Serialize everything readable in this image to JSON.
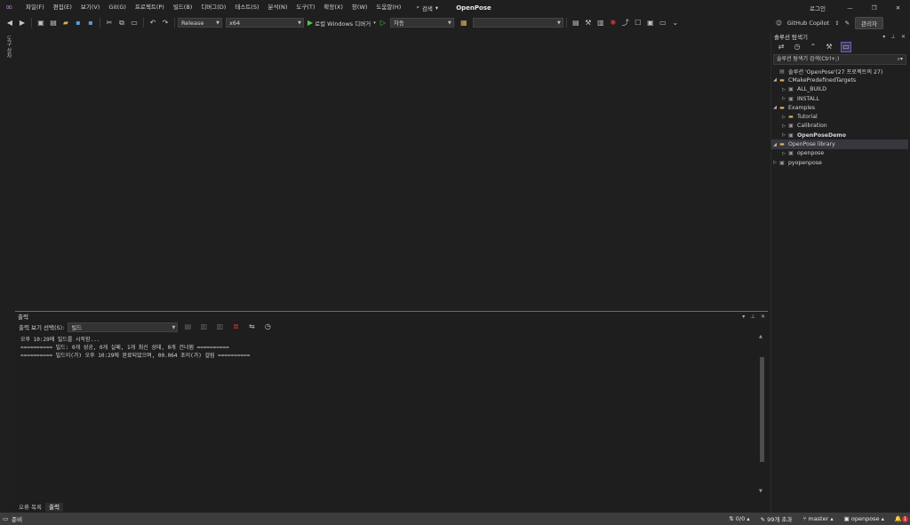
{
  "titlebar": {
    "menu": [
      "파일(F)",
      "편집(E)",
      "보기(V)",
      "Git(G)",
      "프로젝트(P)",
      "빌드(B)",
      "디버그(D)",
      "테스트(S)",
      "분석(N)",
      "도구(T)",
      "확장(X)",
      "창(W)",
      "도움말(H)"
    ],
    "search_label": "검색",
    "project_name": "OpenPose",
    "login_label": "로그인",
    "copilot_label": "GitHub Copilot",
    "admin_label": "관리자"
  },
  "toolbar": {
    "configuration": "Release",
    "platform": "x64",
    "run_label": "로컬 Windows 디버거",
    "auto_label": "자동",
    "extra_combo": ""
  },
  "left_gutter": {
    "label": "도구 상자"
  },
  "output": {
    "title": "출력",
    "source_label": "출력 보기 선택(S):",
    "source_value": "빌드",
    "lines": [
      "오후 10:29에 빌드를 시작함...",
      "========== 빌드: 0개 성공, 0개 실패, 1개 최신 상태, 0개 건너뜀 ==========",
      "========== 빌드이(가) 오후 10:29에 완료되었으며, 00.064 초이(가) 걸림 =========="
    ],
    "tabs": [
      "오류 목록",
      "출력"
    ]
  },
  "solution": {
    "title": "솔루션 탐색기",
    "search_placeholder": "솔루션 탐색기 검색(Ctrl+;)",
    "root": "솔루션 'OpenPose'(27 프로젝트의 27)",
    "nodes": [
      {
        "label": "CMakePredefinedTargets",
        "type": "folder",
        "expanded": true
      },
      {
        "label": "ALL_BUILD",
        "type": "project"
      },
      {
        "label": "INSTALL",
        "type": "project"
      },
      {
        "label": "Examples",
        "type": "folder",
        "expanded": true
      },
      {
        "label": "Tutorial",
        "type": "folder"
      },
      {
        "label": "Calibration",
        "type": "project"
      },
      {
        "label": "OpenPoseDemo",
        "type": "project",
        "bold": true
      },
      {
        "label": "OpenPose library",
        "type": "folder",
        "expanded": true,
        "selected": true
      },
      {
        "label": "openpose",
        "type": "project"
      },
      {
        "label": "pyopenpose",
        "type": "project"
      }
    ]
  },
  "statusbar": {
    "ready": "준비",
    "changes": "0/0",
    "commits": "99개 초과",
    "branch": "master",
    "repo": "openpose",
    "notif_count": "1"
  }
}
